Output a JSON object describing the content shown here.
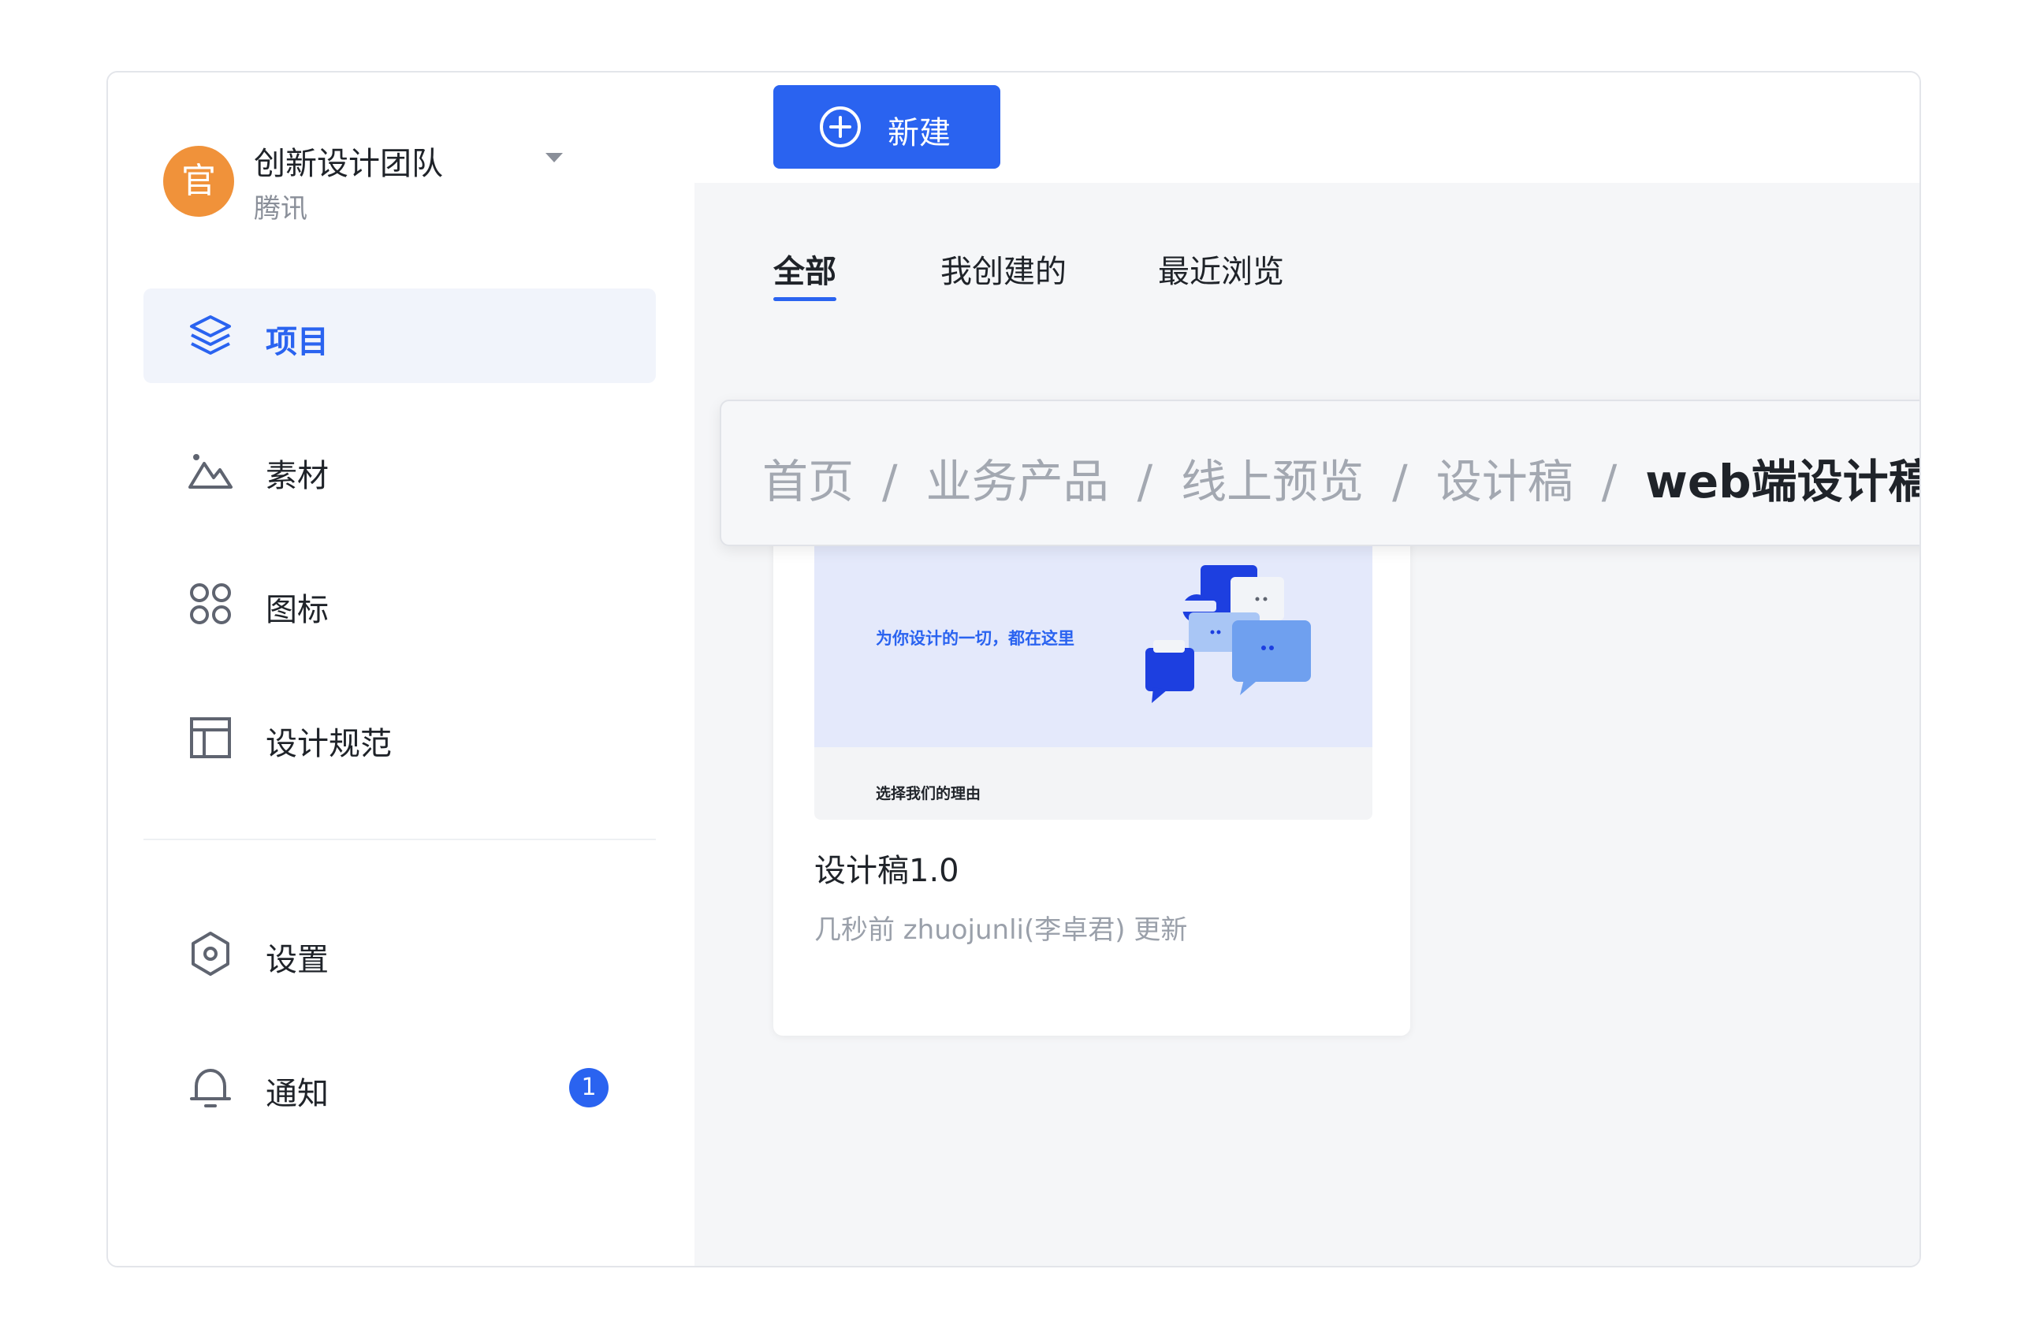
{
  "team": {
    "avatar_text": "官",
    "name": "创新设计团队",
    "org": "腾讯"
  },
  "sidebar": {
    "items": [
      {
        "label": "项目",
        "icon": "layers-icon",
        "active": true
      },
      {
        "label": "素材",
        "icon": "image-icon"
      },
      {
        "label": "图标",
        "icon": "grid-icon"
      },
      {
        "label": "设计规范",
        "icon": "layout-icon"
      },
      {
        "label": "设置",
        "icon": "settings-icon"
      },
      {
        "label": "通知",
        "icon": "bell-icon",
        "badge": "1"
      }
    ]
  },
  "toolbar": {
    "new_label": "新建"
  },
  "tabs": [
    {
      "label": "全部",
      "active": true
    },
    {
      "label": "我创建的"
    },
    {
      "label": "最近浏览"
    }
  ],
  "breadcrumb": {
    "items": [
      "首页",
      "业务产品",
      "线上预览",
      "设计稿",
      "web端设计稿"
    ],
    "separator": "/"
  },
  "card": {
    "thumb_headline": "为你设计的一切，都在这里",
    "thumb_subhead": "选择我们的理由",
    "title": "设计稿1.0",
    "meta": "几秒前 zhuojunli(李卓君) 更新"
  },
  "colors": {
    "primary": "#2a63f0",
    "avatar": "#f0923a",
    "main_bg": "#f5f6f8"
  }
}
